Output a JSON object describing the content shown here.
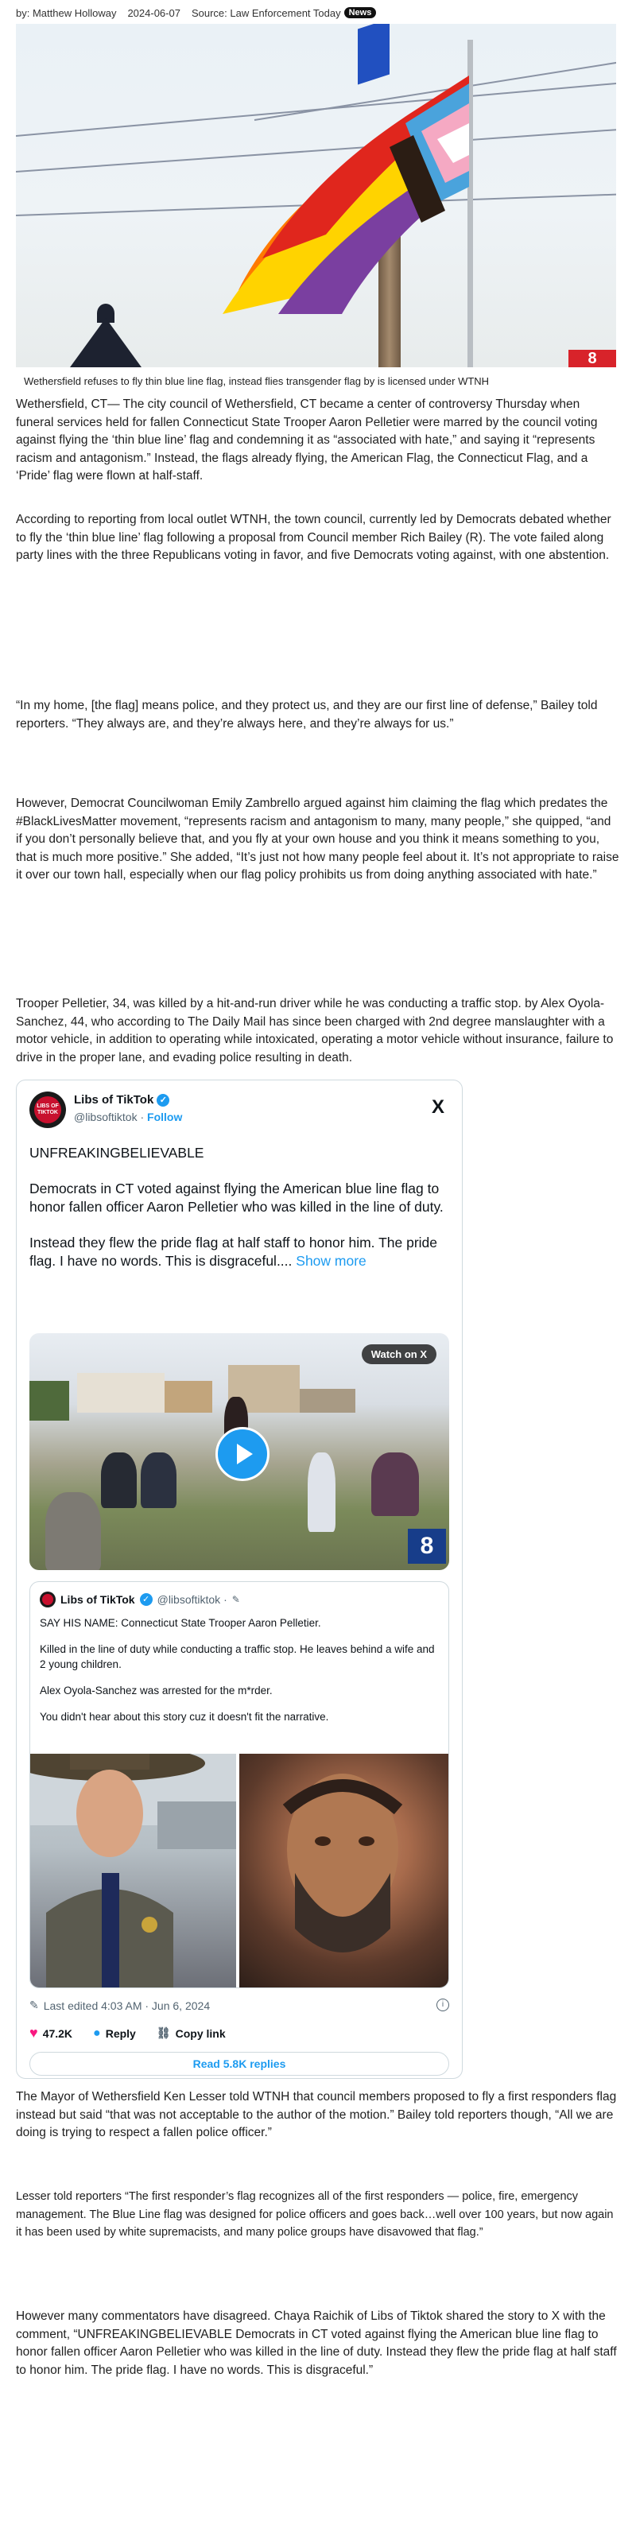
{
  "byline": {
    "author": "by: Matthew Holloway",
    "date": "2024-06-07",
    "source": "Source: Law Enforcement Today",
    "badge": "News"
  },
  "hero": {
    "caption": "Wethersfield refuses to fly thin blue line flag, instead flies transgender flag by is licensed under WTNH",
    "logo_text": "8"
  },
  "article": {
    "p1": "Wethersfield, CT— The city council of Wethersfield, CT became a center of controversy Thursday when funeral services held for fallen Connecticut State Trooper Aaron Pelletier were marred by the council voting against flying the ‘thin blue line’ flag and condemning it as “associated with hate,” and saying it “represents racism and antagonism.” Instead, the flags already flying, the American Flag, the Connecticut Flag, and a ‘Pride’ flag were flown at half-staff.",
    "p2": "According to reporting from local outlet WTNH, the town council, currently led by Democrats debated whether to fly the ‘thin blue line’ flag following a proposal from Council member Rich Bailey (R). The vote failed along party lines with the three Republicans voting in favor, and five Democrats voting against, with one abstention.",
    "p3": "“In my home, [the flag] means police, and they protect us, and they are our first line of defense,” Bailey told reporters. “They always are, and they’re always here, and they’re always for us.”",
    "p4": "However, Democrat Councilwoman Emily Zambrello argued against him claiming the flag which predates the #BlackLivesMatter movement, “represents racism and antagonism to many, many people,” she quipped, “and if you don’t personally believe that, and you fly at your own house and you think it means something to you, that is much more positive.”  She added, “It’s just not how many people feel about it. It’s not appropriate to raise it over our town hall, especially when our flag policy prohibits us from doing anything associated with hate.”",
    "p5": "Trooper Pelletier, 34, was killed by a hit-and-run driver while he was conducting a traffic stop. by Alex Oyola-Sanchez, 44, who according to The Daily Mail has since been charged with 2nd degree manslaughter with a motor vehicle, in addition to operating while intoxicated, operating a motor vehicle without insurance, failure to drive in the proper lane, and evading police resulting in death.",
    "p6": "The Mayor of Wethersfield Ken Lesser told WTNH that council members proposed to fly a first responders flag instead but said “that was not acceptable to the author of the motion.” Bailey told reporters though,  “All we are doing is trying to respect a fallen police officer.”",
    "p7": "Lesser told reporters “The first responder’s flag recognizes all of the first responders — police, fire, emergency management. The Blue Line flag was designed for police officers and goes back…well over 100 years, but now again it has been used by white supremacists, and many police groups have disavowed that flag.”",
    "p8": "However many commentators have disagreed. Chaya Raichik of Libs of Tiktok shared the story to X with the comment, “UNFREAKINGBELIEVABLE Democrats in CT voted against flying the American blue line flag to honor fallen officer Aaron Pelletier who was killed in the line of duty. Instead they flew the pride flag at half staff to honor him. The pride flag. I have no words. This is disgraceful.”"
  },
  "tweet": {
    "name": "Libs of TikTok",
    "handle": "@libsoftiktok",
    "separator": "·",
    "follow": "Follow",
    "x_logo": "𝕏",
    "avatar_text": "LIBS OF TIKTOK",
    "text1": "UNFREAKINGBELIEVABLE",
    "text2": "Democrats in CT voted against flying the American blue line flag to honor fallen officer Aaron Pelletier who was killed in the line of duty.",
    "text3": "Instead they flew the pride flag at half staff to honor him. The pride flag. I have no words. This is disgraceful.... ",
    "show_more": "Show more",
    "watch_label": "Watch on X",
    "video_logo": "8",
    "quote": {
      "name": "Libs of TikTok",
      "handle": "@libsoftiktok ·",
      "line1": "SAY HIS NAME: Connecticut State Trooper Aaron Pelletier.",
      "line2": "Killed in the line of duty while conducting a traffic stop. He leaves behind a wife and 2 young children.",
      "line3": "Alex Oyola-Sanchez was arrested for the m*rder.",
      "line4": "You didn't hear about this story cuz it doesn't fit the narrative."
    },
    "edited": "Last edited 4:03 AM · Jun 6, 2024",
    "likes": "47.2K",
    "reply": "Reply",
    "copy_link": "Copy link",
    "read_replies": "Read 5.8K replies",
    "colors": {
      "accent": "#1d9bf0",
      "heart": "#f91880"
    }
  }
}
